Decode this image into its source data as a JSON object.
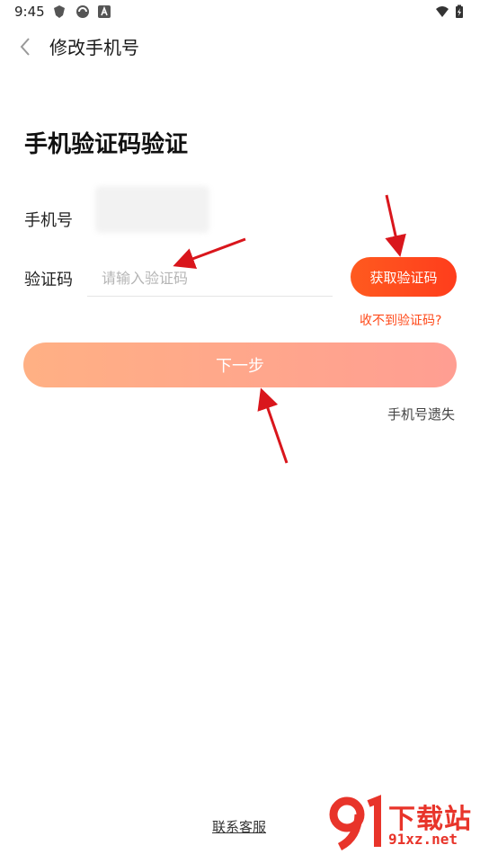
{
  "status_bar": {
    "time": "9:45",
    "icons": [
      "app-notification-icon",
      "sync-icon",
      "a-icon",
      "wifi-icon",
      "battery-charging-icon"
    ]
  },
  "header": {
    "title": "修改手机号",
    "back_icon": "chevron-left-icon"
  },
  "main": {
    "heading": "手机验证码验证",
    "phone_label": "手机号",
    "code_label": "验证码",
    "code_placeholder": "请输入验证码",
    "code_value": "",
    "get_code_button": "获取验证码",
    "no_code_link": "收不到验证码?",
    "next_button": "下一步",
    "lost_phone_link": "手机号遗失"
  },
  "footer": {
    "contact_link": "联系客服"
  },
  "watermark": {
    "logo_text": "91",
    "title": "下载站",
    "site": "91xz.net"
  },
  "colors": {
    "accent": "#ff4a1a",
    "button_gradient_start": "#ffb084",
    "button_gradient_end": "#ff9e92",
    "annotation_arrow": "#d9161c"
  }
}
